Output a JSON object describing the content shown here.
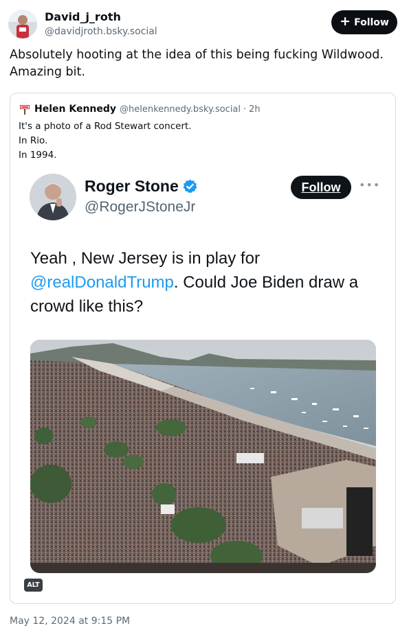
{
  "author": {
    "name": "David_j_roth",
    "handle": "@davidjroth.bsky.social",
    "follow_label": "Follow"
  },
  "post": {
    "text": "Absolutely hooting at the idea of this being fucking Wildwood. Amazing bit.",
    "timestamp": "May 12, 2024 at 9:15 PM"
  },
  "quote": {
    "author_name": "Helen Kennedy",
    "author_handle": "@helenkennedy.bsky.social",
    "separator": "·",
    "time": "2h",
    "lines": [
      "It's a photo of a Rod Stewart concert.",
      "In Rio.",
      "In 1994."
    ],
    "alt_badge": "ALT"
  },
  "embedded_tweet": {
    "name": "Roger Stone",
    "handle": "@RogerJStoneJr",
    "follow_label": "Follow",
    "more_icon": "ellipsis-icon",
    "text_before": "Yeah , New Jersey is in play for ",
    "mention": "@realDonaldTrump",
    "text_after": ". Could Joe Biden draw a crowd like this?",
    "verified_color": "#1d9bf0"
  },
  "colors": {
    "accent": "#1d9bf0",
    "follow_bg": "#0b0f14",
    "muted": "#5a6a79"
  }
}
